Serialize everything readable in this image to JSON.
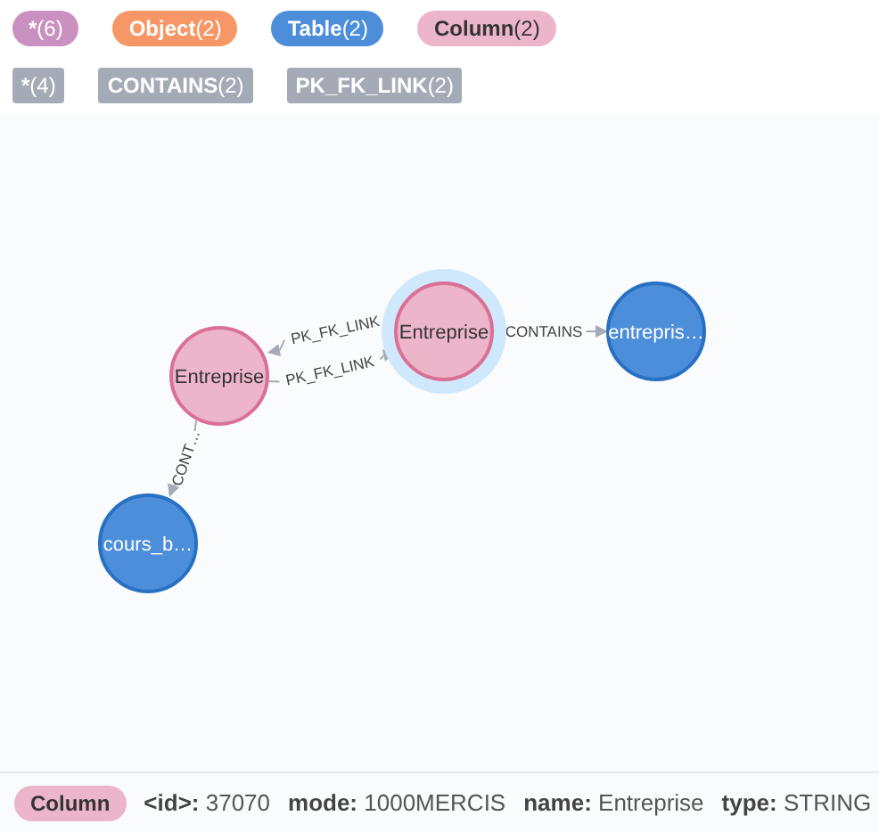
{
  "node_labels": [
    {
      "name": "*",
      "count": "(6)",
      "color": "#c990c0",
      "dark_text": false
    },
    {
      "name": "Object",
      "count": "(2)",
      "color": "#f79767",
      "dark_text": false
    },
    {
      "name": "Table",
      "count": "(2)",
      "color": "#4c8eda",
      "dark_text": false
    },
    {
      "name": "Column",
      "count": "(2)",
      "color": "#ecb5c9",
      "dark_text": true
    }
  ],
  "relationship_types": [
    {
      "name": "*",
      "count": "(4)"
    },
    {
      "name": "CONTAINS",
      "count": "(2)"
    },
    {
      "name": "PK_FK_LINK",
      "count": "(2)"
    }
  ],
  "graph": {
    "nodes": [
      {
        "caption": "Entreprise",
        "kind": "column",
        "selected": false
      },
      {
        "caption": "Entreprise",
        "kind": "column",
        "selected": true
      },
      {
        "caption": "entrepris…",
        "kind": "table",
        "selected": false
      },
      {
        "caption": "cours_b…",
        "kind": "table",
        "selected": false
      }
    ],
    "relationships": [
      {
        "caption": "PK_FK_LINK"
      },
      {
        "caption": "PK_FK_LINK"
      },
      {
        "caption": "CONTAINS"
      },
      {
        "caption": "CONT…"
      }
    ]
  },
  "inspector": {
    "label": "Column",
    "kind": "column",
    "properties": [
      "**<id>:** 37070",
      "**mode:** 1000MERCIS",
      "**name:** Entreprise",
      "**type:** STRING"
    ]
  }
}
